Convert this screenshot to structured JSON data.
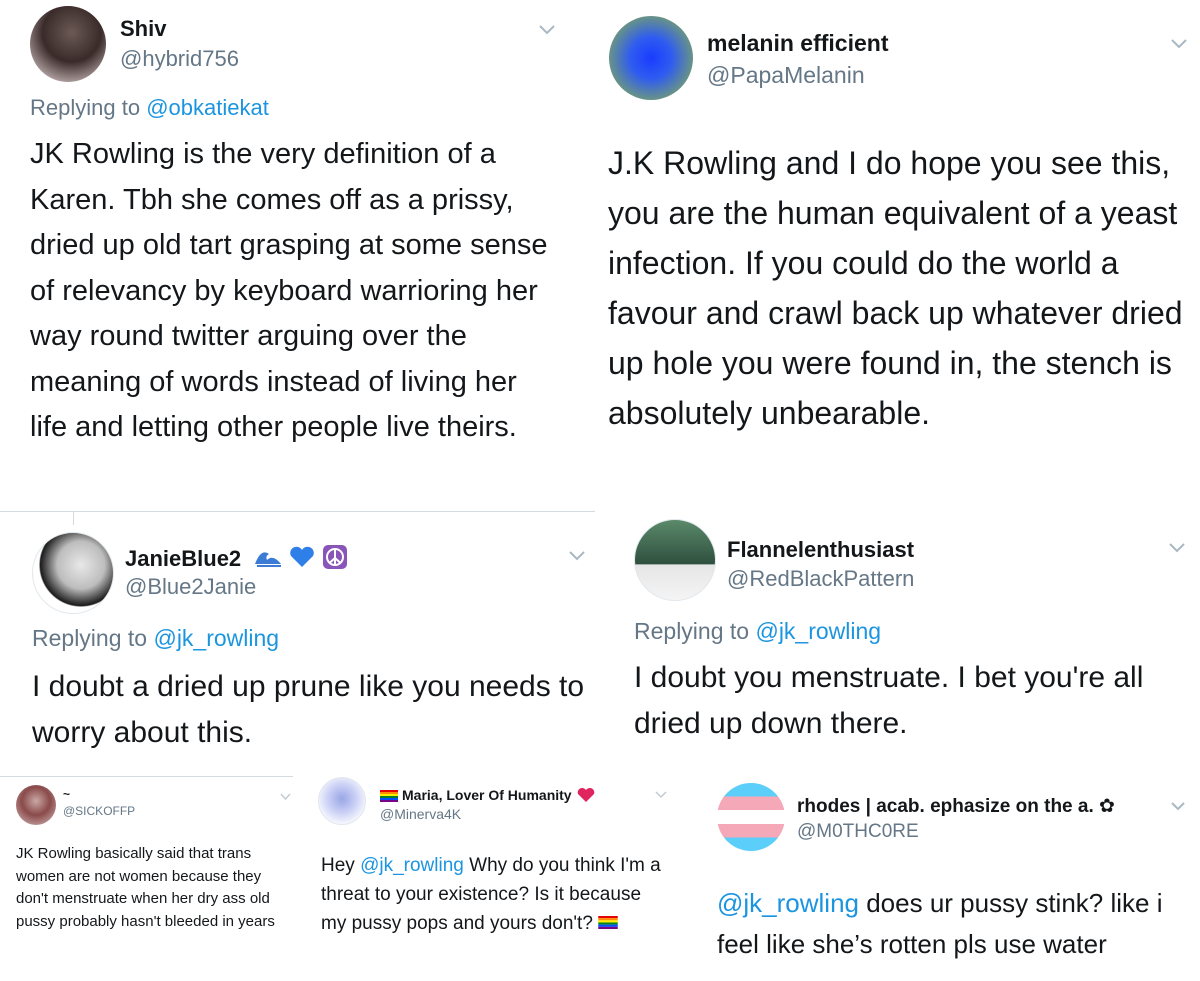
{
  "tweets": [
    {
      "name": "Shiv",
      "handle": "@hybrid756",
      "replying_prefix": "Replying to ",
      "replying_to": "@obkatiekat",
      "text": "JK Rowling is the very definition of a Karen. Tbh she comes off as a prissy, dried up old tart grasping at some sense of relevancy by keyboard warrioring her way round twitter arguing over the meaning of words instead of living her life and letting other people live theirs."
    },
    {
      "name": "melanin efficient",
      "handle": "@PapaMelanin",
      "text": "J.K Rowling and I do hope you see this, you are the human equivalent of a yeast infection. If you could do the world a favour and crawl back up whatever dried up hole you were found in, the stench is absolutely unbearable."
    },
    {
      "name": "JanieBlue2",
      "handle": "@Blue2Janie",
      "replying_prefix": "Replying to ",
      "replying_to": "@jk_rowling",
      "text": "I doubt a dried up prune like you needs to worry about this."
    },
    {
      "name": "Flannelenthusiast",
      "handle": "@RedBlackPattern",
      "replying_prefix": "Replying to ",
      "replying_to": "@jk_rowling",
      "text": "I doubt you menstruate. I bet you're all dried up down there."
    },
    {
      "name": "~",
      "handle": "@SICKOFFP",
      "text": "JK Rowling basically said that trans women are not women because they don't menstruate when her dry ass old pussy probably hasn't bleeded in years"
    },
    {
      "name": "Maria, Lover Of Humanity",
      "handle": "@Minerva4K",
      "text_prefix": "Hey ",
      "mention": "@jk_rowling",
      "text": " Why do you think I'm a threat to your existence? Is it because my pussy pops and yours don't?"
    },
    {
      "name": "rhodes | acab. ephasize on the a. ✿",
      "handle": "@M0THC0RE",
      "mention": "@jk_rowling",
      "text": " does ur pussy stink? like i feel like she’s rotten pls use water"
    }
  ],
  "icons": {
    "chevron": "chevron-down-icon",
    "wave_emoji": "water-wave-icon",
    "heart_emoji": "blue-heart-icon",
    "peace_emoji": "peace-symbol-icon",
    "rainbow_flag": "rainbow-flag-icon",
    "red_heart": "red-heart-icon"
  },
  "colors": {
    "text": "#14171a",
    "secondary": "#657786",
    "link": "#1b95e0",
    "divider": "#d4dbe0"
  }
}
